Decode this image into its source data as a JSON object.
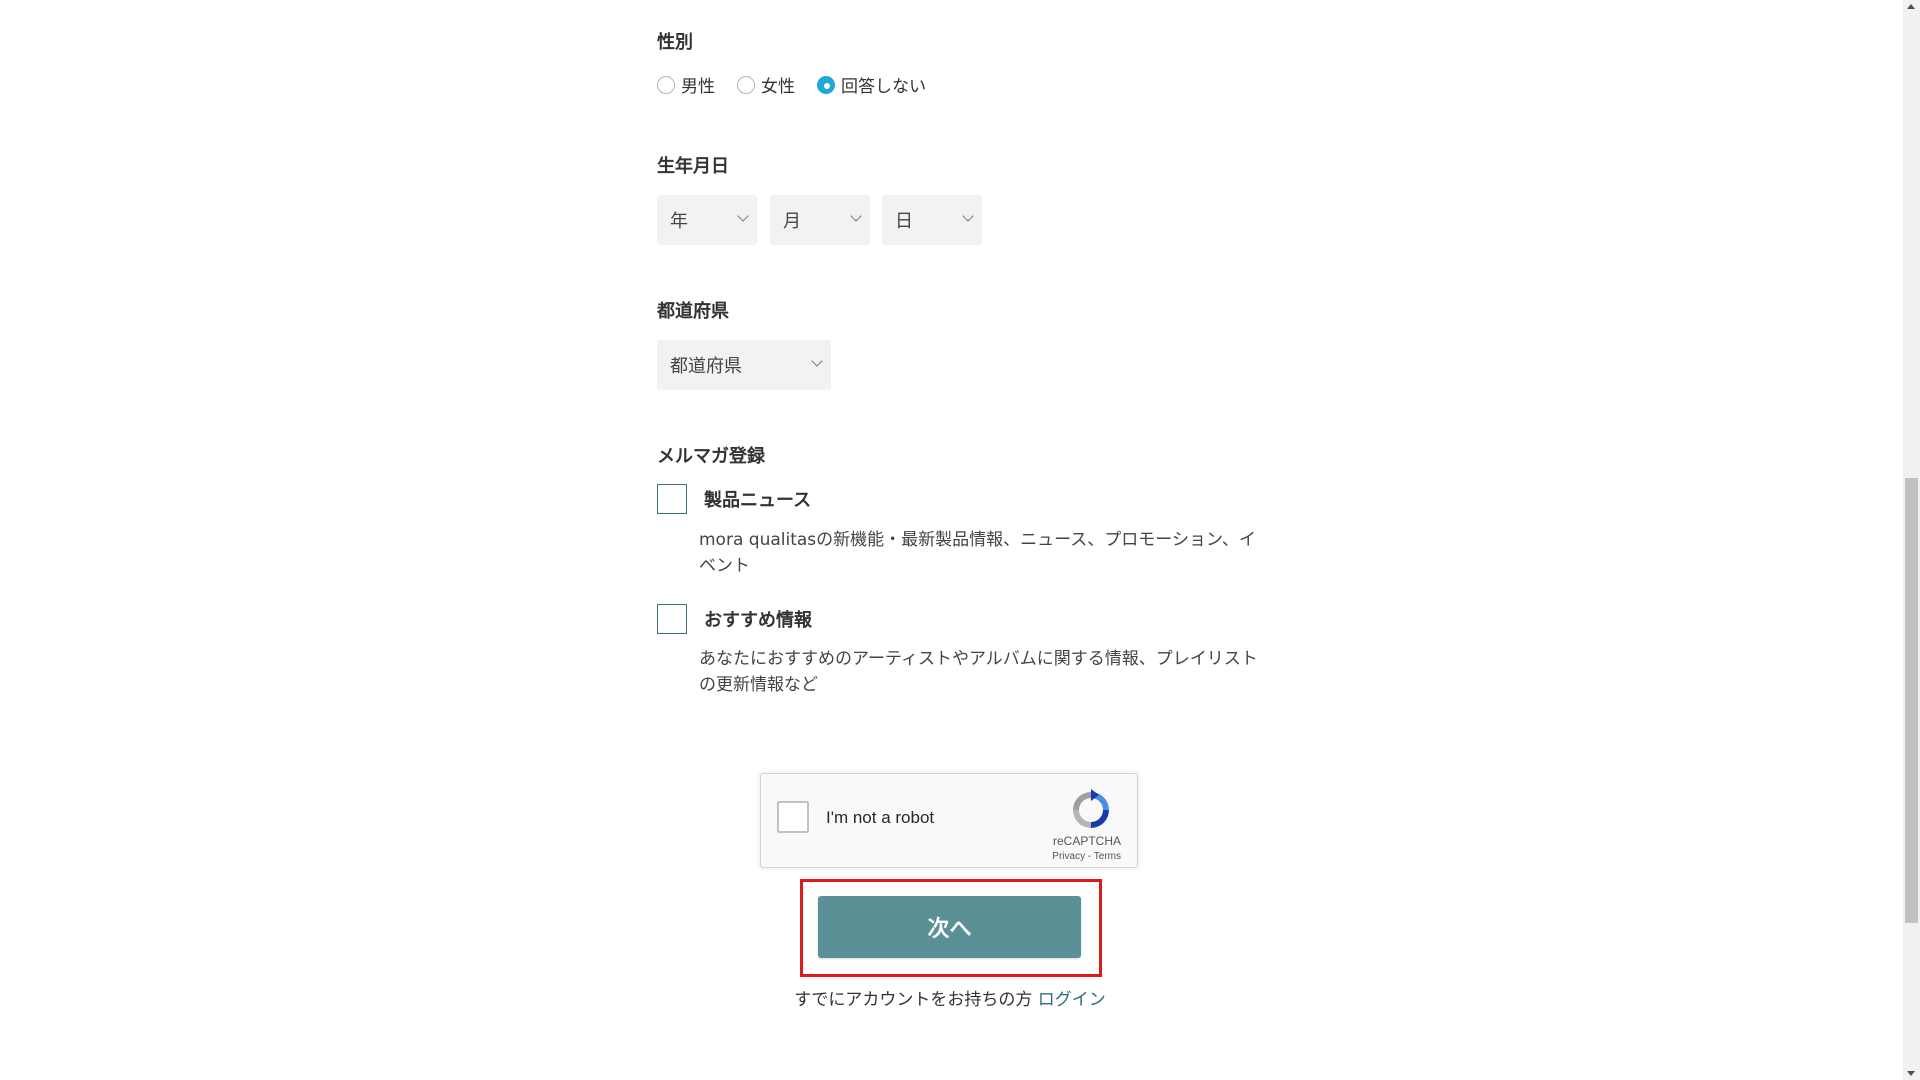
{
  "gender": {
    "label": "性別",
    "options": [
      {
        "label": "男性",
        "checked": false
      },
      {
        "label": "女性",
        "checked": false
      },
      {
        "label": "回答しない",
        "checked": true
      }
    ]
  },
  "birthday": {
    "label": "生年月日",
    "year": "年",
    "month": "月",
    "day": "日"
  },
  "prefecture": {
    "label": "都道府県",
    "value": "都道府県"
  },
  "newsletter": {
    "label": "メルマガ登録",
    "items": [
      {
        "label": "製品ニュース",
        "description": "mora qualitasの新機能・最新製品情報、ニュース、プロモーション、イベント",
        "checked": false
      },
      {
        "label": "おすすめ情報",
        "description": "あなたにおすすめのアーティストやアルバムに関する情報、プレイリストの更新情報など",
        "checked": false
      }
    ]
  },
  "recaptcha": {
    "text": "I'm not a robot",
    "brand": "reCAPTCHA",
    "links": "Privacy - Terms"
  },
  "actions": {
    "next_label": "次へ",
    "login_prompt": "すでにアカウントをお持ちの方",
    "login_link": "ログイン"
  },
  "colors": {
    "accent_radio": "#1fa9d6",
    "button": "#5b9097",
    "highlight": "#e01a1a",
    "link": "#2e6e7a"
  }
}
